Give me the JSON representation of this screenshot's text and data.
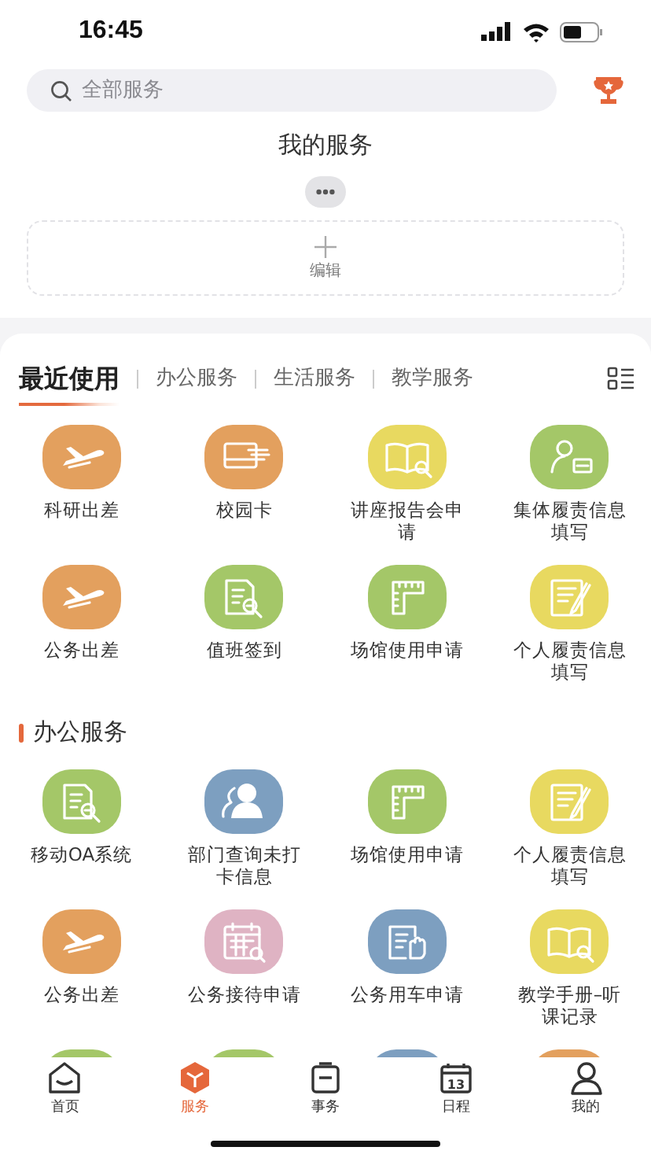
{
  "status_bar": {
    "time": "16:45"
  },
  "search": {
    "placeholder": "全部服务"
  },
  "my_services": {
    "title": "我的服务",
    "edit_label": "编辑"
  },
  "tabs": [
    {
      "label": "最近使用",
      "selected": true
    },
    {
      "label": "办公服务",
      "selected": false
    },
    {
      "label": "生活服务",
      "selected": false
    },
    {
      "label": "教学服务",
      "selected": false
    }
  ],
  "recent": [
    {
      "label": "科研出差",
      "kind": "plane",
      "color": "#e3a05e"
    },
    {
      "label": "校园卡",
      "kind": "card",
      "color": "#e3a05e"
    },
    {
      "label": "讲座报告会申请",
      "kind": "book",
      "color": "#e8d960"
    },
    {
      "label": "集体履责信息填写",
      "kind": "person-card",
      "color": "#a4c768"
    },
    {
      "label": "公务出差",
      "kind": "plane",
      "color": "#e3a05e"
    },
    {
      "label": "值班签到",
      "kind": "doc-search",
      "color": "#a4c768"
    },
    {
      "label": "场馆使用申请",
      "kind": "ruler",
      "color": "#a4c768"
    },
    {
      "label": "个人履责信息填写",
      "kind": "form",
      "color": "#e8d960"
    }
  ],
  "office": {
    "title": "办公服务",
    "items": [
      {
        "label": "移动OA系统",
        "kind": "doc-search",
        "color": "#a4c768"
      },
      {
        "label": "部门查询未打卡信息",
        "kind": "people",
        "color": "#7d9fc0"
      },
      {
        "label": "场馆使用申请",
        "kind": "ruler",
        "color": "#a4c768"
      },
      {
        "label": "个人履责信息填写",
        "kind": "form",
        "color": "#e8d960"
      },
      {
        "label": "公务出差",
        "kind": "plane",
        "color": "#e3a05e"
      },
      {
        "label": "公务接待申请",
        "kind": "calendar",
        "color": "#dfb3c3"
      },
      {
        "label": "公务用车申请",
        "kind": "hand",
        "color": "#7d9fc0"
      },
      {
        "label": "教学手册–听课记录",
        "kind": "book",
        "color": "#e8d960"
      }
    ],
    "peek": [
      {
        "color": "#a4c768"
      },
      {
        "color": "#a4c768"
      },
      {
        "color": "#7d9fc0"
      },
      {
        "color": "#e3a05e"
      }
    ]
  },
  "nav": [
    {
      "label": "首页",
      "kind": "home",
      "selected": false
    },
    {
      "label": "服务",
      "kind": "cube",
      "selected": true
    },
    {
      "label": "事务",
      "kind": "clipboard",
      "selected": false
    },
    {
      "label": "日程",
      "kind": "calendar",
      "selected": false,
      "badge": "13"
    },
    {
      "label": "我的",
      "kind": "user",
      "selected": false
    }
  ]
}
